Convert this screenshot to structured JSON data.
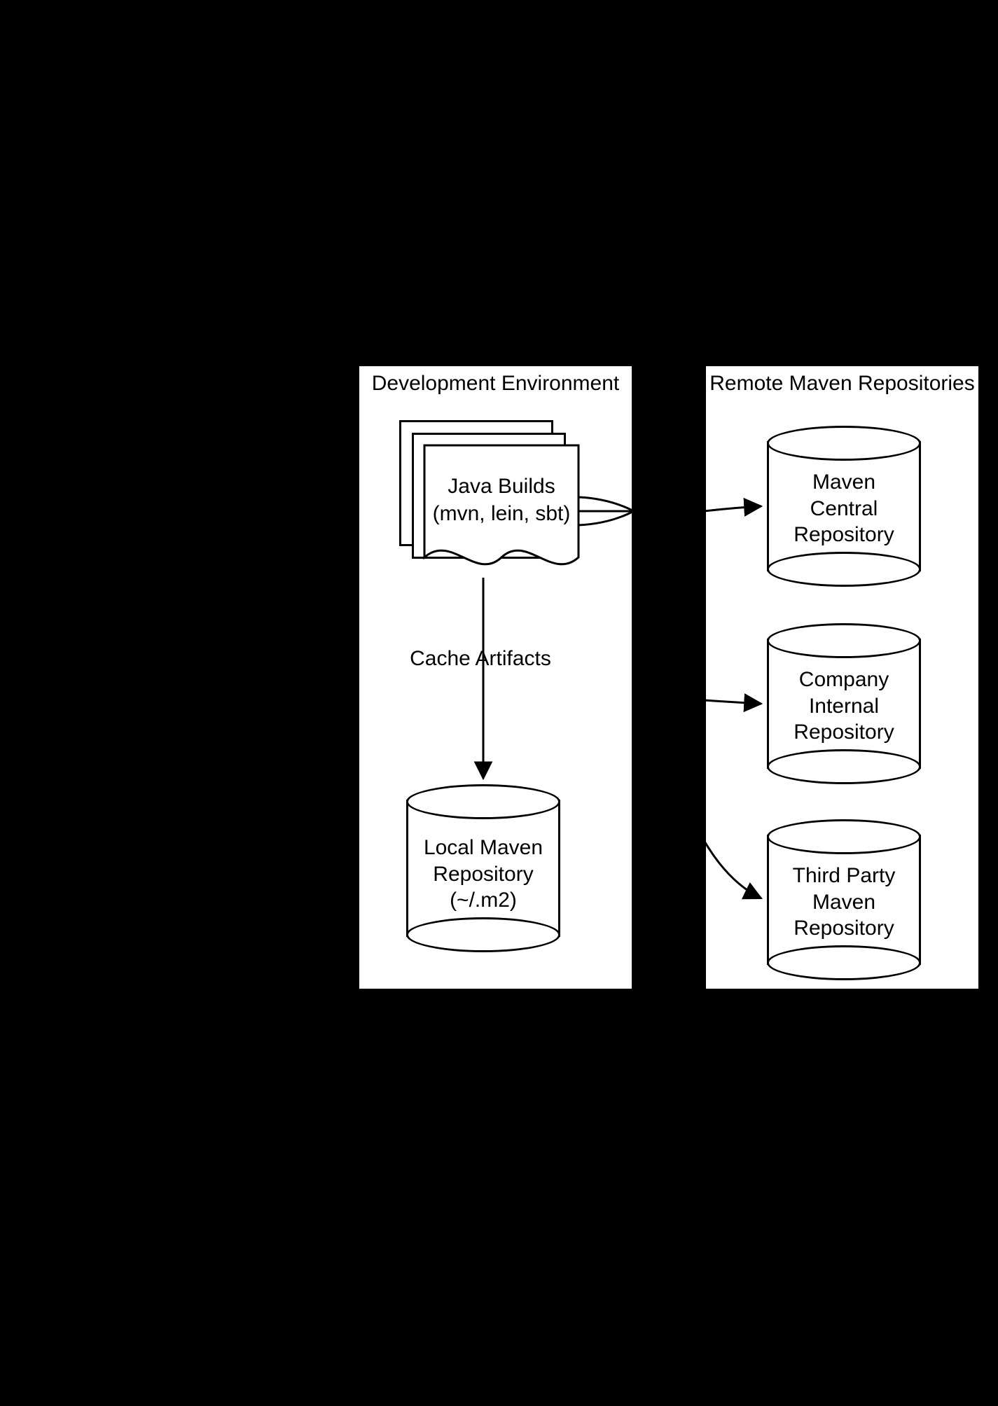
{
  "dev_env": {
    "title": "Development Environment",
    "java_builds_line1": "Java Builds",
    "java_builds_line2": "(mvn, lein, sbt)",
    "cache_label": "Cache Artifacts",
    "local_repo_line1": "Local Maven",
    "local_repo_line2": "Repository",
    "local_repo_line3": "(~/.m2)"
  },
  "remote": {
    "title": "Remote Maven Repositories",
    "maven_central_line1": "Maven",
    "maven_central_line2": "Central",
    "maven_central_line3": "Repository",
    "company_line1": "Company",
    "company_line2": "Internal",
    "company_line3": "Repository",
    "third_line1": "Third Party",
    "third_line2": "Maven",
    "third_line3": "Repository"
  }
}
